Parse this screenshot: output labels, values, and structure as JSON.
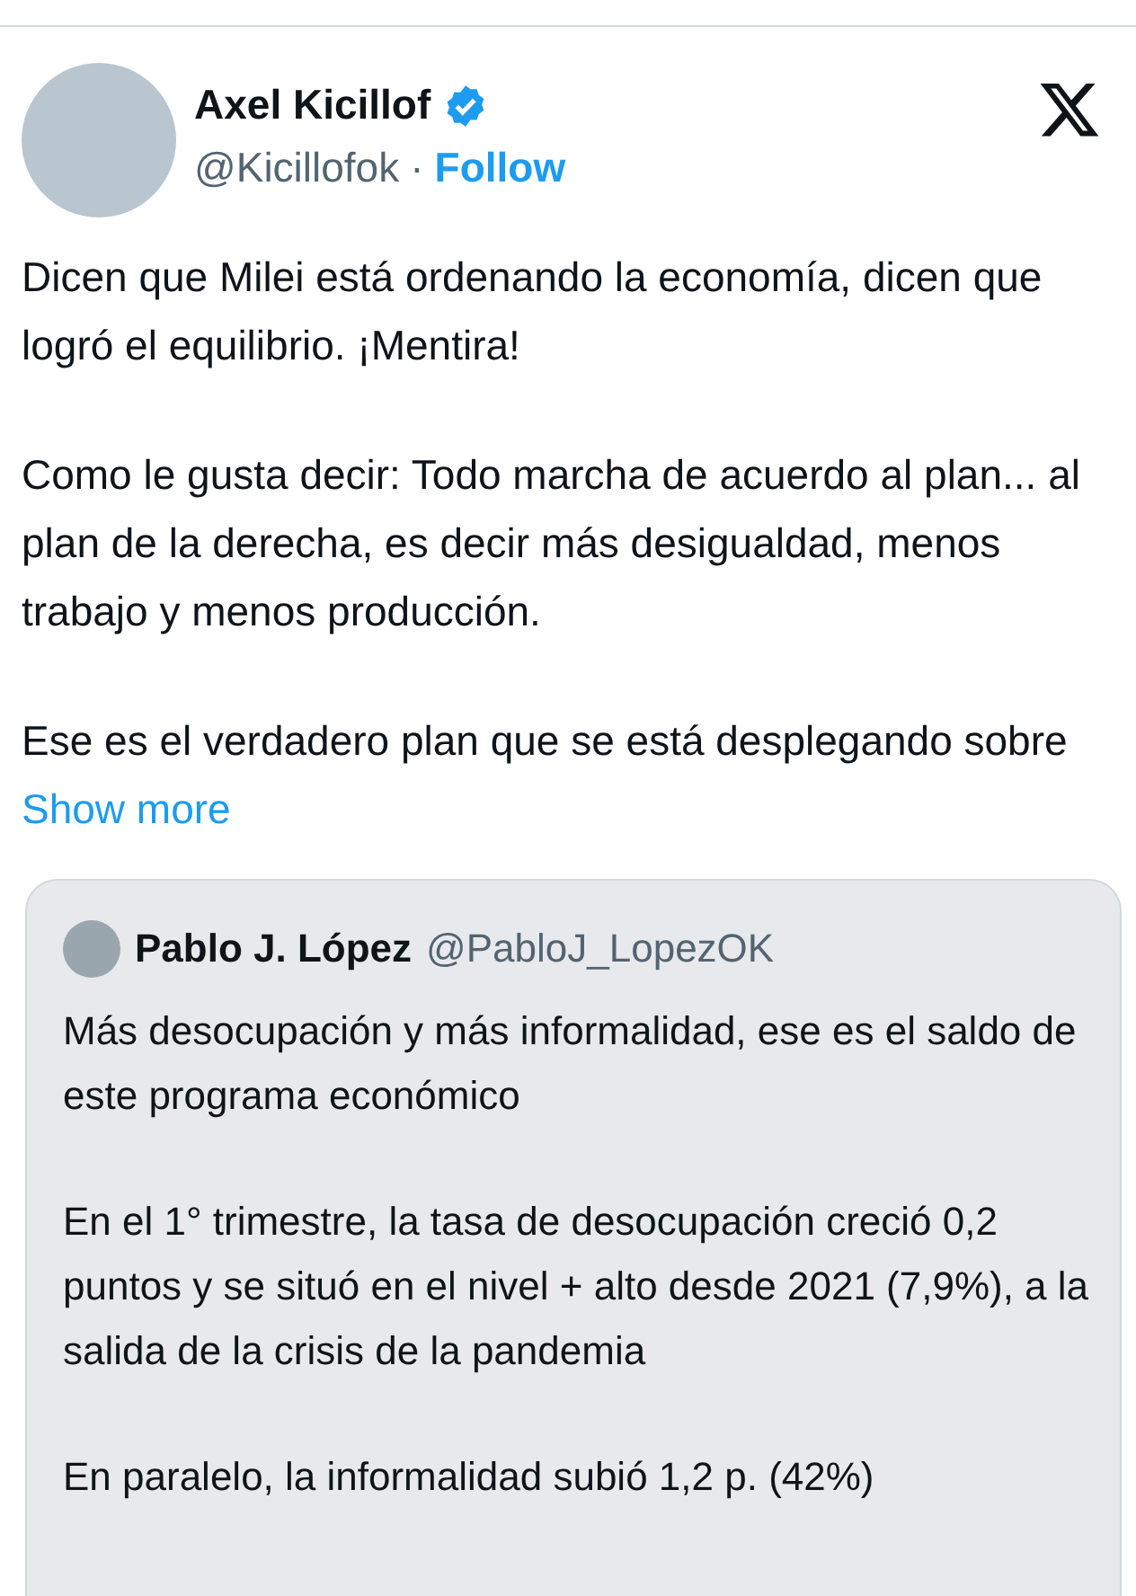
{
  "author": {
    "name": "Axel Kicillof",
    "verified": true,
    "handle": "@Kicillofok",
    "separator": "·",
    "follow": "Follow"
  },
  "paragraphs": [
    "Dicen que Milei está ordenando la economía, dicen que logró el equilibrio. ¡Mentira!",
    "Como le gusta decir: Todo marcha de acuerdo al plan... al plan de la derecha, es decir más desigualdad, menos trabajo y menos producción.",
    "Ese es el verdadero plan que se está desplegando sobre"
  ],
  "show_more": "Show more",
  "quote": {
    "name": "Pablo J. López",
    "handle": "@PabloJ_LopezOK",
    "paragraphs": [
      "Más desocupación y más informalidad, ese es el saldo de este programa económico",
      "En el 1° trimestre, la tasa de desocupación creció 0,2 puntos y se situó en el nivel + alto desde 2021 (7,9%), a la salida de la crisis de la pandemia",
      "En paralelo, la informalidad subió 1,2 p. (42%)"
    ]
  }
}
